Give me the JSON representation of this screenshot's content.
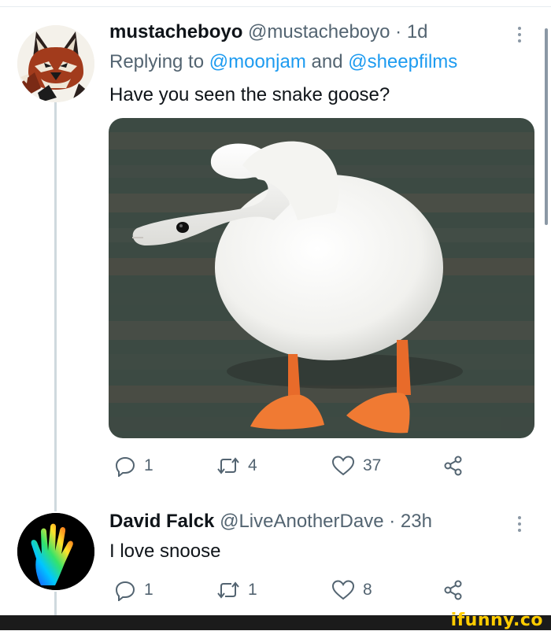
{
  "tweet1": {
    "display_name": "mustacheboyo",
    "handle_time": " @mustacheboyo · 1d",
    "replying_prefix": "Replying to ",
    "mention_1": "@moonjam",
    "replying_and": " and ",
    "mention_2": "@sheepfilms",
    "text": "Have you seen the snake goose?",
    "replies": "1",
    "retweets": "4",
    "likes": "37"
  },
  "tweet2": {
    "display_name": "David Falck",
    "handle_time": " @LiveAnotherDave · 23h",
    "text": "I love snoose",
    "replies": "1",
    "retweets": "1",
    "likes": "8"
  },
  "footer": {
    "brand": "ifunny.co"
  },
  "colors": {
    "accent": "#1d9bf0",
    "secondary_text": "#536471",
    "brand": "#ffcc00",
    "brand_bar": "#1b1b1b"
  },
  "icons": [
    "more-dots-icon",
    "reply-icon",
    "retweet-icon",
    "like-heart-icon",
    "share-icon"
  ]
}
